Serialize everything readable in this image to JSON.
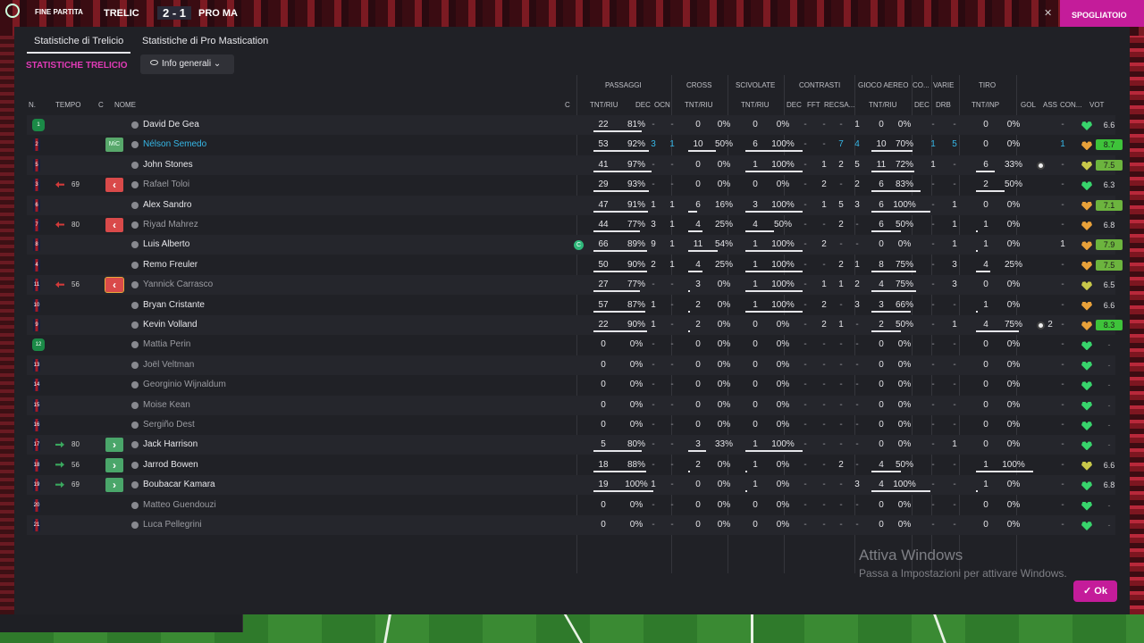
{
  "topbar": {
    "end_label": "FINE PARTITA",
    "home": "TRELIC",
    "score": "2 - 1",
    "away": "PRO MA",
    "close_icon": "x-icon",
    "right_button": "SPOGLIATOIO"
  },
  "tabs": [
    {
      "label": "Statistiche di Trelicio",
      "active": true
    },
    {
      "label": "Statistiche di Pro Mastication",
      "active": false
    }
  ],
  "section_title": "STATISTICHE TRELICIO",
  "view_selector": {
    "label": "Info generali",
    "icon": "eye-icon"
  },
  "group_headers": {
    "passaggi": "PASSAGGI",
    "cross": "CROSS",
    "scivolate": "SCIVOLATE",
    "contrasti": "CONTRASTI",
    "gioco_aereo": "GIOCO AEREO",
    "co": "CO...",
    "varie": "VARIE",
    "tiro": "TIRO"
  },
  "columns": {
    "n": "N.",
    "tempo": "TEMPO",
    "c": "C",
    "nome": "NOME",
    "c2": "C",
    "pass_tnt": "TNT/RIU",
    "pass_dec": "DEC",
    "pass_ocn": "OCN",
    "cross_tnt": "TNT/RIU",
    "sciv_tnt": "TNT/RIU",
    "contr_dec": "DEC",
    "contr_fft": "FFT",
    "contr_rec": "REC",
    "contr_sa": "SA...",
    "aereo_tnt": "TNT/RIU",
    "co_dec": "DEC",
    "varie_drb": "DRB",
    "tiro_tnt": "TNT/INP",
    "gol": "GOL",
    "ass": "ASS",
    "con": "CON...",
    "vot": "VOT"
  },
  "players": [
    {
      "n": "1",
      "name": "David De Gea",
      "gk": true,
      "pass": [
        "22",
        "81%"
      ],
      "pdec": "-",
      "pocn": "-",
      "cross": [
        "0",
        "0%"
      ],
      "sciv": [
        "0",
        "0%"
      ],
      "cdec": "-",
      "cfft": "-",
      "crec": "-",
      "csa": "1",
      "aereo": [
        "0",
        "0%"
      ],
      "codec": "-",
      "drb": "-",
      "tiro": [
        "0",
        "0%"
      ],
      "gol": "",
      "ass": "-",
      "heart": "g",
      "vot": "6.6",
      "vclass": ""
    },
    {
      "n": "2",
      "name": "Nélson Semedo",
      "hl": true,
      "mic": "MiC",
      "pass": [
        "53",
        "92%"
      ],
      "pdec": "3",
      "pocn": "1",
      "cross": [
        "10",
        "50%"
      ],
      "sciv": [
        "6",
        "100%"
      ],
      "cdec": "-",
      "cfft": "-",
      "crec": "7",
      "csa": "4",
      "aereo": [
        "10",
        "70%"
      ],
      "codec": "1",
      "drb": "5",
      "tiro": [
        "0",
        "0%"
      ],
      "gol": "",
      "ass": "1",
      "heart": "o",
      "vot": "8.7",
      "vclass": "top"
    },
    {
      "n": "5",
      "name": "John Stones",
      "pass": [
        "41",
        "97%"
      ],
      "pdec": "-",
      "pocn": "-",
      "cross": [
        "0",
        "0%"
      ],
      "sciv": [
        "1",
        "100%"
      ],
      "cdec": "-",
      "cfft": "1",
      "crec": "2",
      "csa": "5",
      "aereo": [
        "11",
        "72%"
      ],
      "codec": "1",
      "drb": "-",
      "tiro": [
        "6",
        "33%"
      ],
      "gol": "ball",
      "ass": "-",
      "heart": "y",
      "vot": "7.5",
      "vclass": "hi"
    },
    {
      "n": "3",
      "name": "Rafael Toloi",
      "dim": true,
      "sub": "out",
      "min": "69",
      "pass": [
        "29",
        "93%"
      ],
      "pdec": "-",
      "pocn": "-",
      "cross": [
        "0",
        "0%"
      ],
      "sciv": [
        "0",
        "0%"
      ],
      "cdec": "-",
      "cfft": "2",
      "crec": "-",
      "csa": "2",
      "aereo": [
        "6",
        "83%"
      ],
      "codec": "-",
      "drb": "-",
      "tiro": [
        "2",
        "50%"
      ],
      "gol": "",
      "ass": "-",
      "heart": "g",
      "vot": "6.3",
      "vclass": ""
    },
    {
      "n": "6",
      "name": "Alex Sandro",
      "pass": [
        "47",
        "91%"
      ],
      "pdec": "1",
      "pocn": "1",
      "cross": [
        "6",
        "16%"
      ],
      "sciv": [
        "3",
        "100%"
      ],
      "cdec": "-",
      "cfft": "1",
      "crec": "5",
      "csa": "3",
      "aereo": [
        "6",
        "100%"
      ],
      "codec": "-",
      "drb": "1",
      "tiro": [
        "0",
        "0%"
      ],
      "gol": "",
      "ass": "-",
      "heart": "o",
      "vot": "7.1",
      "vclass": "hi"
    },
    {
      "n": "7",
      "name": "Riyad Mahrez",
      "dim": true,
      "sub": "out",
      "min": "80",
      "pass": [
        "44",
        "77%"
      ],
      "pdec": "3",
      "pocn": "1",
      "cross": [
        "4",
        "25%"
      ],
      "sciv": [
        "4",
        "50%"
      ],
      "cdec": "-",
      "cfft": "-",
      "crec": "2",
      "csa": "-",
      "aereo": [
        "6",
        "50%"
      ],
      "codec": "-",
      "drb": "1",
      "tiro": [
        "1",
        "0%"
      ],
      "gol": "",
      "ass": "-",
      "heart": "o",
      "vot": "6.8",
      "vclass": ""
    },
    {
      "n": "8",
      "name": "Luis Alberto",
      "cap": true,
      "pass": [
        "66",
        "89%"
      ],
      "pdec": "9",
      "pocn": "1",
      "cross": [
        "11",
        "54%"
      ],
      "sciv": [
        "1",
        "100%"
      ],
      "cdec": "-",
      "cfft": "2",
      "crec": "-",
      "csa": "-",
      "aereo": [
        "0",
        "0%"
      ],
      "codec": "-",
      "drb": "1",
      "tiro": [
        "1",
        "0%"
      ],
      "gol": "",
      "ass": "1",
      "heart": "o",
      "vot": "7.9",
      "vclass": "hi"
    },
    {
      "n": "4",
      "name": "Remo Freuler",
      "pass": [
        "50",
        "90%"
      ],
      "pdec": "2",
      "pocn": "1",
      "cross": [
        "4",
        "25%"
      ],
      "sciv": [
        "1",
        "100%"
      ],
      "cdec": "-",
      "cfft": "-",
      "crec": "2",
      "csa": "1",
      "aereo": [
        "8",
        "75%"
      ],
      "codec": "-",
      "drb": "3",
      "tiro": [
        "4",
        "25%"
      ],
      "gol": "",
      "ass": "-",
      "heart": "o",
      "vot": "7.5",
      "vclass": "hi"
    },
    {
      "n": "11",
      "name": "Yannick Carrasco",
      "dim": true,
      "sub": "out",
      "min": "56",
      "sel": true,
      "pass": [
        "27",
        "77%"
      ],
      "pdec": "-",
      "pocn": "-",
      "cross": [
        "3",
        "0%"
      ],
      "sciv": [
        "1",
        "100%"
      ],
      "cdec": "-",
      "cfft": "1",
      "crec": "1",
      "csa": "2",
      "aereo": [
        "4",
        "75%"
      ],
      "codec": "-",
      "drb": "3",
      "tiro": [
        "0",
        "0%"
      ],
      "gol": "",
      "ass": "-",
      "heart": "y",
      "vot": "6.5",
      "vclass": ""
    },
    {
      "n": "10",
      "name": "Bryan Cristante",
      "pass": [
        "57",
        "87%"
      ],
      "pdec": "1",
      "pocn": "-",
      "cross": [
        "2",
        "0%"
      ],
      "sciv": [
        "1",
        "100%"
      ],
      "cdec": "-",
      "cfft": "2",
      "crec": "-",
      "csa": "3",
      "aereo": [
        "3",
        "66%"
      ],
      "codec": "-",
      "drb": "-",
      "tiro": [
        "1",
        "0%"
      ],
      "gol": "",
      "ass": "-",
      "heart": "o",
      "vot": "6.6",
      "vclass": ""
    },
    {
      "n": "9",
      "name": "Kevin Volland",
      "pass": [
        "22",
        "90%"
      ],
      "pdec": "1",
      "pocn": "-",
      "cross": [
        "2",
        "0%"
      ],
      "sciv": [
        "0",
        "0%"
      ],
      "cdec": "-",
      "cfft": "2",
      "crec": "1",
      "csa": "-",
      "aereo": [
        "2",
        "50%"
      ],
      "codec": "-",
      "drb": "1",
      "tiro": [
        "4",
        "75%"
      ],
      "gol": "ball2",
      "ass": "-",
      "heart": "o",
      "vot": "8.3",
      "vclass": "top"
    },
    {
      "n": "12",
      "name": "Mattia Perin",
      "dim": true,
      "gk": true,
      "pass": [
        "0",
        "0%"
      ],
      "pdec": "-",
      "pocn": "-",
      "cross": [
        "0",
        "0%"
      ],
      "sciv": [
        "0",
        "0%"
      ],
      "cdec": "-",
      "cfft": "-",
      "crec": "-",
      "csa": "-",
      "aereo": [
        "0",
        "0%"
      ],
      "codec": "-",
      "drb": "-",
      "tiro": [
        "0",
        "0%"
      ],
      "gol": "",
      "ass": "-",
      "heart": "g",
      "vot": "-",
      "vclass": "none"
    },
    {
      "n": "13",
      "name": "Joël Veltman",
      "dim": true,
      "pass": [
        "0",
        "0%"
      ],
      "pdec": "-",
      "pocn": "-",
      "cross": [
        "0",
        "0%"
      ],
      "sciv": [
        "0",
        "0%"
      ],
      "cdec": "-",
      "cfft": "-",
      "crec": "-",
      "csa": "-",
      "aereo": [
        "0",
        "0%"
      ],
      "codec": "-",
      "drb": "-",
      "tiro": [
        "0",
        "0%"
      ],
      "gol": "",
      "ass": "-",
      "heart": "g",
      "vot": "-",
      "vclass": "none"
    },
    {
      "n": "14",
      "name": "Georginio Wijnaldum",
      "dim": true,
      "pass": [
        "0",
        "0%"
      ],
      "pdec": "-",
      "pocn": "-",
      "cross": [
        "0",
        "0%"
      ],
      "sciv": [
        "0",
        "0%"
      ],
      "cdec": "-",
      "cfft": "-",
      "crec": "-",
      "csa": "-",
      "aereo": [
        "0",
        "0%"
      ],
      "codec": "-",
      "drb": "-",
      "tiro": [
        "0",
        "0%"
      ],
      "gol": "",
      "ass": "-",
      "heart": "g",
      "vot": "-",
      "vclass": "none"
    },
    {
      "n": "15",
      "name": "Moise Kean",
      "dim": true,
      "pass": [
        "0",
        "0%"
      ],
      "pdec": "-",
      "pocn": "-",
      "cross": [
        "0",
        "0%"
      ],
      "sciv": [
        "0",
        "0%"
      ],
      "cdec": "-",
      "cfft": "-",
      "crec": "-",
      "csa": "-",
      "aereo": [
        "0",
        "0%"
      ],
      "codec": "-",
      "drb": "-",
      "tiro": [
        "0",
        "0%"
      ],
      "gol": "",
      "ass": "-",
      "heart": "g",
      "vot": "-",
      "vclass": "none"
    },
    {
      "n": "16",
      "name": "Sergiño Dest",
      "dim": true,
      "pass": [
        "0",
        "0%"
      ],
      "pdec": "-",
      "pocn": "-",
      "cross": [
        "0",
        "0%"
      ],
      "sciv": [
        "0",
        "0%"
      ],
      "cdec": "-",
      "cfft": "-",
      "crec": "-",
      "csa": "-",
      "aereo": [
        "0",
        "0%"
      ],
      "codec": "-",
      "drb": "-",
      "tiro": [
        "0",
        "0%"
      ],
      "gol": "",
      "ass": "-",
      "heart": "g",
      "vot": "-",
      "vclass": "none"
    },
    {
      "n": "17",
      "name": "Jack Harrison",
      "sub": "in",
      "min": "80",
      "pass": [
        "5",
        "80%"
      ],
      "pdec": "-",
      "pocn": "-",
      "cross": [
        "3",
        "33%"
      ],
      "sciv": [
        "1",
        "100%"
      ],
      "cdec": "-",
      "cfft": "-",
      "crec": "-",
      "csa": "-",
      "aereo": [
        "0",
        "0%"
      ],
      "codec": "-",
      "drb": "1",
      "tiro": [
        "0",
        "0%"
      ],
      "gol": "",
      "ass": "-",
      "heart": "g",
      "vot": "-",
      "vclass": "none"
    },
    {
      "n": "18",
      "name": "Jarrod Bowen",
      "sub": "in",
      "min": "56",
      "pass": [
        "18",
        "88%"
      ],
      "pdec": "-",
      "pocn": "-",
      "cross": [
        "2",
        "0%"
      ],
      "sciv": [
        "1",
        "0%"
      ],
      "cdec": "-",
      "cfft": "-",
      "crec": "2",
      "csa": "-",
      "aereo": [
        "4",
        "50%"
      ],
      "codec": "-",
      "drb": "-",
      "tiro": [
        "1",
        "100%"
      ],
      "gol": "",
      "ass": "-",
      "heart": "y",
      "vot": "6.6",
      "vclass": ""
    },
    {
      "n": "19",
      "name": "Boubacar Kamara",
      "sub": "in",
      "min": "69",
      "pass": [
        "19",
        "100%"
      ],
      "pdec": "1",
      "pocn": "-",
      "cross": [
        "0",
        "0%"
      ],
      "sciv": [
        "1",
        "0%"
      ],
      "cdec": "-",
      "cfft": "-",
      "crec": "-",
      "csa": "3",
      "aereo": [
        "4",
        "100%"
      ],
      "codec": "-",
      "drb": "-",
      "tiro": [
        "1",
        "0%"
      ],
      "gol": "",
      "ass": "-",
      "heart": "g",
      "vot": "6.8",
      "vclass": ""
    },
    {
      "n": "20",
      "name": "Matteo Guendouzi",
      "dim": true,
      "pass": [
        "0",
        "0%"
      ],
      "pdec": "-",
      "pocn": "-",
      "cross": [
        "0",
        "0%"
      ],
      "sciv": [
        "0",
        "0%"
      ],
      "cdec": "-",
      "cfft": "-",
      "crec": "-",
      "csa": "-",
      "aereo": [
        "0",
        "0%"
      ],
      "codec": "-",
      "drb": "-",
      "tiro": [
        "0",
        "0%"
      ],
      "gol": "",
      "ass": "-",
      "heart": "g",
      "vot": "-",
      "vclass": "none"
    },
    {
      "n": "21",
      "name": "Luca Pellegrini",
      "dim": true,
      "pass": [
        "0",
        "0%"
      ],
      "pdec": "-",
      "pocn": "-",
      "cross": [
        "0",
        "0%"
      ],
      "sciv": [
        "0",
        "0%"
      ],
      "cdec": "-",
      "cfft": "-",
      "crec": "-",
      "csa": "-",
      "aereo": [
        "0",
        "0%"
      ],
      "codec": "-",
      "drb": "-",
      "tiro": [
        "0",
        "0%"
      ],
      "gol": "",
      "ass": "-",
      "heart": "g",
      "vot": "-",
      "vclass": "none"
    }
  ],
  "watermark": {
    "title": "Attiva Windows",
    "subtitle": "Passa a Impostazioni per attivare Windows."
  },
  "ok_button": "Ok",
  "colors": {
    "accent": "#c41c9a",
    "section": "#e13bb7",
    "rating_top": "#3ec33a",
    "rating_hi": "#6cb43e"
  }
}
